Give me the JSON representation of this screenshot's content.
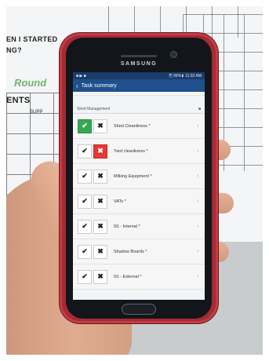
{
  "whiteboard": {
    "line1": "EN I STARTED",
    "line2": "NG?",
    "green_word": "Round",
    "section_word": "ENTS",
    "column_label": "SUPP"
  },
  "phone": {
    "brand": "SAMSUNG",
    "status": {
      "left": "■ ▶ ■",
      "right": "⎘ 99%▮ 11:32 AM"
    },
    "app": {
      "back_icon": "chevron-left",
      "title": "Task summary"
    },
    "section": {
      "title": "Shed Management",
      "icon": "trash-icon"
    },
    "items": [
      {
        "label": "Shed Cleanliness *",
        "state": "pass"
      },
      {
        "label": "Yard cleanliness *",
        "state": "fail"
      },
      {
        "label": "Milking Equipment *",
        "state": "none"
      },
      {
        "label": "VATs *",
        "state": "none"
      },
      {
        "label": "5S - Internal *",
        "state": "none"
      },
      {
        "label": "Shadow Boards *",
        "state": "none"
      },
      {
        "label": "5S - External *",
        "state": "none"
      }
    ],
    "colors": {
      "appbar": "#1f4f8c",
      "pass": "#34a853",
      "fail": "#e53935",
      "body": "#a42a34"
    }
  }
}
